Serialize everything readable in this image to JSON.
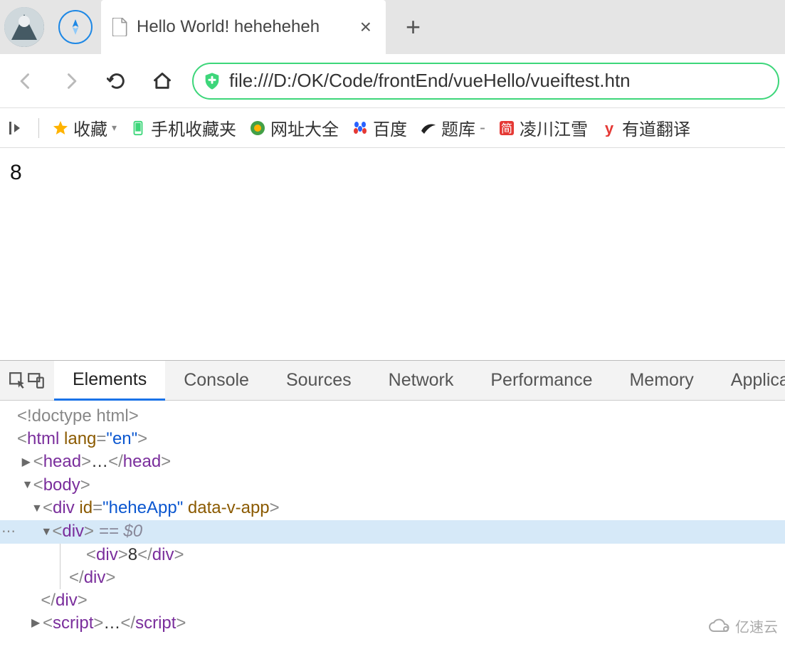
{
  "tab": {
    "title": "Hello World! heheheheh"
  },
  "url": "file:///D:/OK/Code/frontEnd/vueHello/vueiftest.htn",
  "bookmarks": {
    "fav": "收藏",
    "mobile_fav": "手机收藏夹",
    "dir360": "网址大全",
    "baidu": "百度",
    "tiku": "题库",
    "lingchuan": "凌川江雪",
    "youdao": "有道翻译"
  },
  "page": {
    "content": "8"
  },
  "devtools": {
    "tabs": {
      "elements": "Elements",
      "console": "Console",
      "sources": "Sources",
      "network": "Network",
      "performance": "Performance",
      "memory": "Memory",
      "application": "Applicat"
    },
    "dom": {
      "doctype": "<!doctype html>",
      "html_open_pre": "<",
      "html_tag": "html",
      "lang_attr": "lang",
      "lang_val": "\"en\"",
      "head": "head",
      "ellipsis": "…",
      "body": "body",
      "div": "div",
      "id_attr": "id",
      "id_val": "\"heheApp\"",
      "data_v_app": "data-v-app",
      "inner_text": "8",
      "selected_marker": " == $0",
      "script": "script"
    }
  },
  "watermark": "亿速云"
}
